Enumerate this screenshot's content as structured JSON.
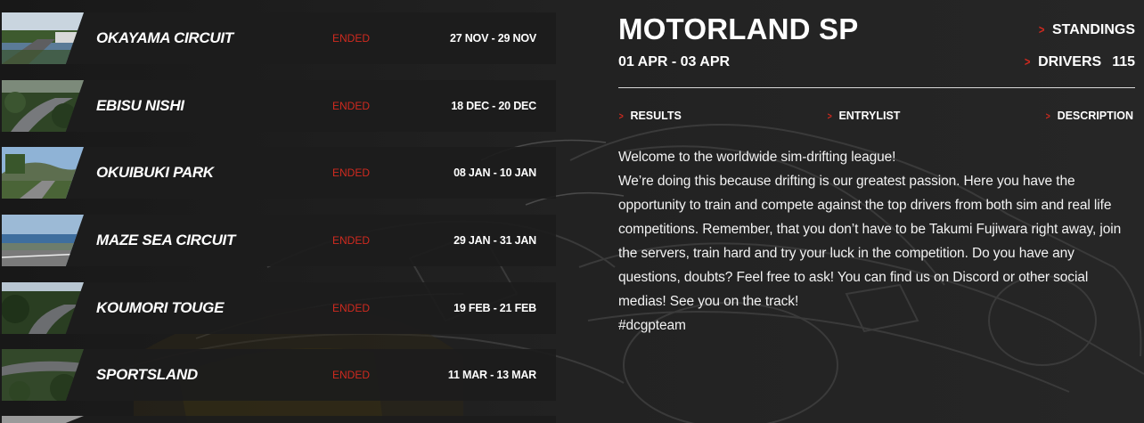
{
  "events": [
    {
      "name": "OKAYAMA CIRCUIT",
      "status": "ENDED",
      "dates": "27 NOV - 29 NOV"
    },
    {
      "name": "EBISU NISHI",
      "status": "ENDED",
      "dates": "18 DEC - 20 DEC"
    },
    {
      "name": "OKUIBUKI PARK",
      "status": "ENDED",
      "dates": "08 JAN - 10 JAN"
    },
    {
      "name": "MAZE SEA CIRCUIT",
      "status": "ENDED",
      "dates": "29 JAN - 31 JAN"
    },
    {
      "name": "KOUMORI TOUGE",
      "status": "ENDED",
      "dates": "19 FEB - 21 FEB"
    },
    {
      "name": "SPORTSLAND",
      "status": "ENDED",
      "dates": "11 MAR - 13 MAR"
    }
  ],
  "detail": {
    "title": "MOTORLAND SP",
    "dates": "01 APR - 03 APR",
    "standings_label": "STANDINGS",
    "drivers_label": "DRIVERS",
    "drivers_count": "115",
    "tabs": {
      "results": "RESULTS",
      "entrylist": "ENTRYLIST",
      "description": "DESCRIPTION"
    },
    "description": [
      "Welcome to the worldwide sim-drifting league!",
      "We’re doing this because drifting is our greatest passion. Here you have the opportunity to train and compete against the top drivers from both sim and real life competitions. Remember, that you don’t have to be Takumi Fujiwara right away, join the servers, train hard and try your luck in the competition. Do you have any questions, doubts? Feel free to ask! You can find us on Discord or other social medias! See you on the track!",
      "#dcgpteam"
    ]
  },
  "colors": {
    "accent": "#d02a1f",
    "background": "#1c1c1c",
    "row": "#1c1c1c",
    "text": "#ffffff"
  },
  "icons": {
    "chevron": "chevron-right-icon"
  }
}
